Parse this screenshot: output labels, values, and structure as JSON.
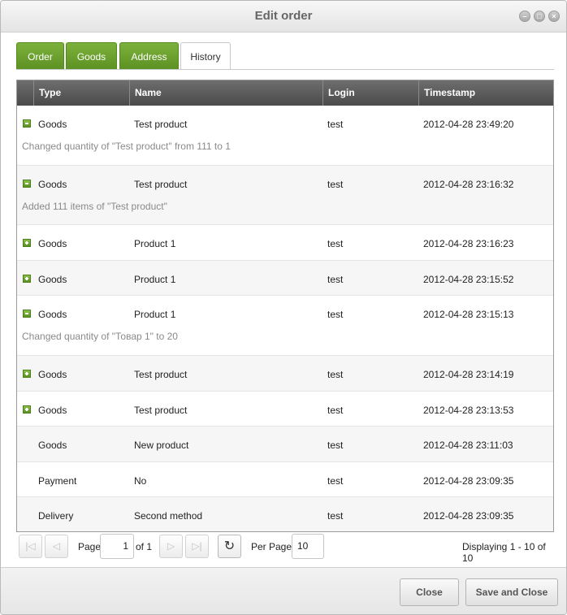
{
  "window": {
    "title": "Edit order"
  },
  "tabs": [
    {
      "label": "Order"
    },
    {
      "label": "Goods"
    },
    {
      "label": "Address"
    },
    {
      "label": "History"
    }
  ],
  "grid": {
    "columns": [
      "Type",
      "Name",
      "Login",
      "Timestamp"
    ],
    "rows": [
      {
        "icon": "minus",
        "type": "Goods",
        "name": "Test product",
        "login": "test",
        "timestamp": "2012-04-28 23:49:20",
        "detail": "Changed quantity of \"Test product\" from 111 to 1"
      },
      {
        "icon": "minus",
        "type": "Goods",
        "name": "Test product",
        "login": "test",
        "timestamp": "2012-04-28 23:16:32",
        "detail": "Added 111 items of \"Test product\""
      },
      {
        "icon": "plus",
        "type": "Goods",
        "name": "Product 1",
        "login": "test",
        "timestamp": "2012-04-28 23:16:23",
        "detail": ""
      },
      {
        "icon": "plus",
        "type": "Goods",
        "name": "Product 1",
        "login": "test",
        "timestamp": "2012-04-28 23:15:52",
        "detail": ""
      },
      {
        "icon": "minus",
        "type": "Goods",
        "name": "Product 1",
        "login": "test",
        "timestamp": "2012-04-28 23:15:13",
        "detail": "Changed quantity of \"Товар 1\" to 20"
      },
      {
        "icon": "plus",
        "type": "Goods",
        "name": "Test product",
        "login": "test",
        "timestamp": "2012-04-28 23:14:19",
        "detail": ""
      },
      {
        "icon": "plus",
        "type": "Goods",
        "name": "Test product",
        "login": "test",
        "timestamp": "2012-04-28 23:13:53",
        "detail": ""
      },
      {
        "icon": "",
        "type": "Goods",
        "name": "New product",
        "login": "test",
        "timestamp": "2012-04-28 23:11:03",
        "detail": ""
      },
      {
        "icon": "",
        "type": "Payment",
        "name": "No",
        "login": "test",
        "timestamp": "2012-04-28 23:09:35",
        "detail": ""
      },
      {
        "icon": "",
        "type": "Delivery",
        "name": "Second method",
        "login": "test",
        "timestamp": "2012-04-28 23:09:35",
        "detail": ""
      }
    ]
  },
  "pager": {
    "page_label": "Page",
    "page_value": "1",
    "of_label": "of 1",
    "per_page_label": "Per Page:",
    "per_page_value": "10",
    "display_text": "Displaying 1 - 10 of 10"
  },
  "footer": {
    "close_label": "Close",
    "save_close_label": "Save and Close"
  },
  "colors": {
    "tab_green": "#6aa22d",
    "header_dark": "#5a5a5a",
    "icon_green": "#6aa22d"
  }
}
